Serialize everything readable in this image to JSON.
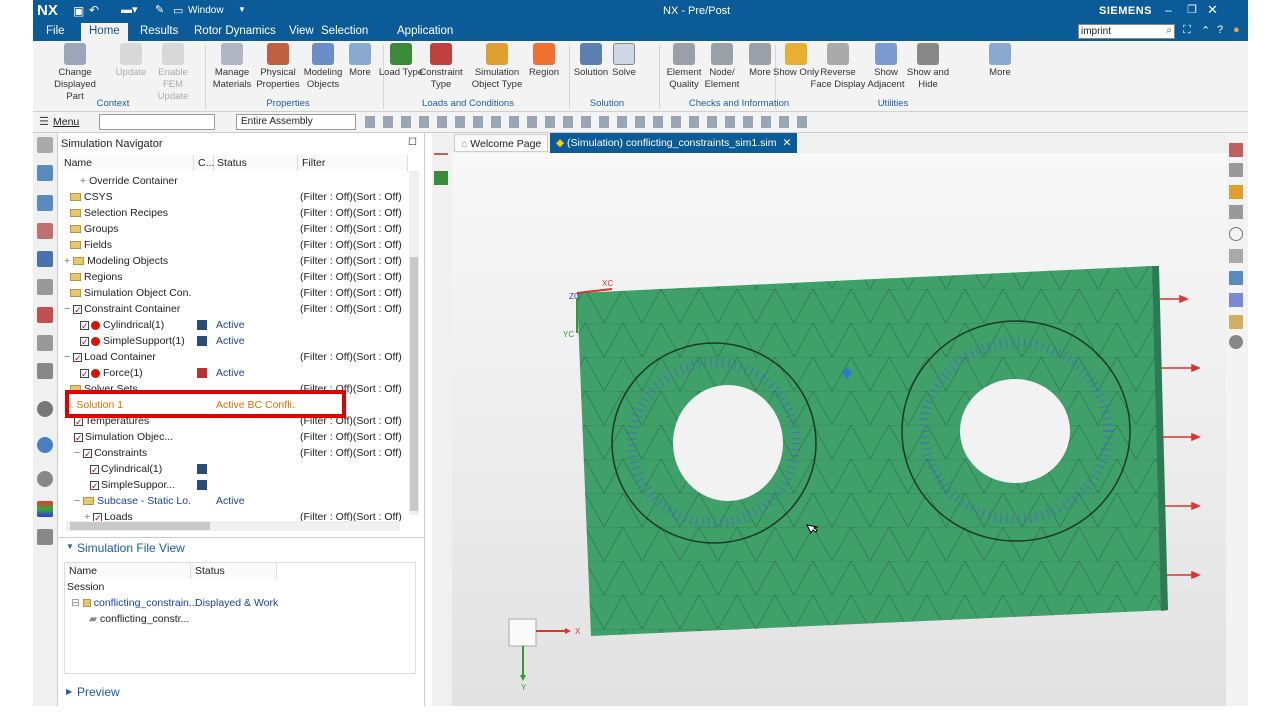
{
  "app": {
    "logo": "NX",
    "window_menu": "Window",
    "title": "NX - Pre/Post",
    "brand": "SIEMENS",
    "search_value": "imprint"
  },
  "menu": {
    "tabs": [
      "File",
      "Home",
      "Results",
      "Rotor Dynamics",
      "View",
      "Selection",
      "Application"
    ]
  },
  "ribbon": {
    "buttons": [
      {
        "label": "Change Displayed Part",
        "disabled": false
      },
      {
        "label": "Update",
        "disabled": true
      },
      {
        "label": "Enable FEM Update",
        "disabled": true
      },
      {
        "label": "Manage Materials",
        "disabled": false
      },
      {
        "label": "Physical Properties",
        "disabled": false
      },
      {
        "label": "Modeling Objects",
        "disabled": false
      },
      {
        "label": "More",
        "disabled": false
      },
      {
        "label": "Load Type",
        "disabled": false
      },
      {
        "label": "Constraint Type",
        "disabled": false
      },
      {
        "label": "Simulation Object Type",
        "disabled": false
      },
      {
        "label": "Region",
        "disabled": false
      },
      {
        "label": "Solution",
        "disabled": false
      },
      {
        "label": "Solve",
        "disabled": false
      },
      {
        "label": "Element Quality",
        "disabled": false
      },
      {
        "label": "Node/ Element",
        "disabled": false
      },
      {
        "label": "More",
        "disabled": false
      },
      {
        "label": "Show Only",
        "disabled": false
      },
      {
        "label": "Reverse Face Display",
        "disabled": false
      },
      {
        "label": "Show Adjacent",
        "disabled": false
      },
      {
        "label": "Show and Hide",
        "disabled": false
      },
      {
        "label": "More",
        "disabled": false
      }
    ],
    "groups": [
      "Context",
      "Properties",
      "Loads and Conditions",
      "Solution",
      "Checks and Information",
      "Utilities"
    ]
  },
  "toolbar": {
    "menu_label": "Menu",
    "filter_value": "",
    "assembly_value": "Entire Assembly"
  },
  "navigator": {
    "title": "Simulation Navigator",
    "columns": [
      "Name",
      "C...",
      "Status",
      "Filter"
    ],
    "rows": [
      {
        "name": "Override Container",
        "status": "",
        "filter": ""
      },
      {
        "name": "CSYS",
        "status": "",
        "filter": "(Filter : Off)(Sort : Off)"
      },
      {
        "name": "Selection Recipes",
        "status": "",
        "filter": "(Filter : Off)(Sort : Off)"
      },
      {
        "name": "Groups",
        "status": "",
        "filter": "(Filter : Off)(Sort : Off)"
      },
      {
        "name": "Fields",
        "status": "",
        "filter": "(Filter : Off)(Sort : Off)"
      },
      {
        "name": "Modeling Objects",
        "status": "",
        "filter": "(Filter : Off)(Sort : Off)"
      },
      {
        "name": "Regions",
        "status": "",
        "filter": "(Filter : Off)(Sort : Off)"
      },
      {
        "name": "Simulation Object Con...",
        "status": "",
        "filter": "(Filter : Off)(Sort : Off)"
      },
      {
        "name": "Constraint Container",
        "status": "",
        "filter": "(Filter : Off)(Sort : Off)"
      },
      {
        "name": "Cylindrical(1)",
        "status": "Active",
        "filter": ""
      },
      {
        "name": "SimpleSupport(1)",
        "status": "Active",
        "filter": ""
      },
      {
        "name": "Load Container",
        "status": "",
        "filter": "(Filter : Off)(Sort : Off)"
      },
      {
        "name": "Force(1)",
        "status": "Active",
        "filter": ""
      },
      {
        "name": "Solver Sets",
        "status": "",
        "filter": "(Filter : Off)(Sort : Off)"
      },
      {
        "name": "Solution 1",
        "status": "Active BC Confli...",
        "filter": ""
      },
      {
        "name": "Temperatures",
        "status": "",
        "filter": "(Filter : Off)(Sort : Off)"
      },
      {
        "name": "Simulation Objec...",
        "status": "",
        "filter": "(Filter : Off)(Sort : Off)"
      },
      {
        "name": "Constraints",
        "status": "",
        "filter": "(Filter : Off)(Sort : Off)"
      },
      {
        "name": "Cylindrical(1)",
        "status": "",
        "filter": ""
      },
      {
        "name": "SimpleSuppor...",
        "status": "",
        "filter": ""
      },
      {
        "name": "Subcase - Static Lo...",
        "status": "Active",
        "filter": ""
      },
      {
        "name": "Loads",
        "status": "",
        "filter": "(Filter : Off)(Sort : Off)"
      }
    ]
  },
  "fileview": {
    "title": "Simulation File View",
    "columns": [
      "Name",
      "Status"
    ],
    "rows": [
      {
        "name": "Session",
        "status": ""
      },
      {
        "name": "conflicting_constrain...",
        "status": "Displayed & Work"
      },
      {
        "name": "conflicting_constr...",
        "status": ""
      }
    ]
  },
  "preview": {
    "label": "Preview"
  },
  "tabs": {
    "welcome": "Welcome Page",
    "sim": "(Simulation) conflicting_constraints_sim1.sim"
  },
  "viewport": {
    "axis_xc": "XC",
    "axis_yc": "YC",
    "axis_zc": "ZC",
    "triad_x": "X",
    "triad_y": "Y"
  },
  "colors": {
    "mesh": "#3fa06a",
    "accent": "#0a5b97",
    "highlight": "#e00000"
  }
}
